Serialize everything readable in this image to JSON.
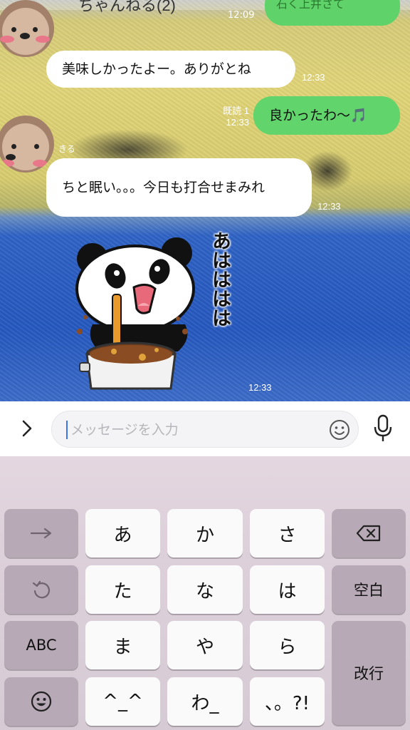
{
  "header": {
    "title_partial": "ちゃんねる(2)",
    "right_partial": "石く上井さて"
  },
  "messages": [
    {
      "id": "m0",
      "side": "right",
      "text": "",
      "time": "12:09"
    },
    {
      "id": "m1",
      "side": "left",
      "text": "美味しかったよー。ありがとね",
      "time": "12:33"
    },
    {
      "id": "m2",
      "side": "right",
      "text": "良かったわ〜🎵",
      "read": "既読 1",
      "time": "12:33"
    },
    {
      "id": "m3",
      "side": "left",
      "sender_partial": "きる",
      "text": "ちと眠い。。。今日も打合せまみれ",
      "time": "12:33"
    },
    {
      "id": "m4",
      "side": "left",
      "type": "sticker",
      "sticker_text": "あはははは",
      "time": "12:33"
    }
  ],
  "input": {
    "placeholder": "メッセージを入力",
    "value": ""
  },
  "icons": {
    "expand": "chevron-right-icon",
    "emoji": "smile-icon",
    "voice": "microphone-icon"
  },
  "keyboard": {
    "rows": [
      [
        "→",
        "あ",
        "か",
        "さ",
        "⌫"
      ],
      [
        "↺",
        "た",
        "な",
        "は",
        "空白"
      ],
      [
        "ABC",
        "ま",
        "や",
        "ら",
        "改行"
      ],
      [
        "☺",
        "^^",
        "わ_",
        "、。?!"
      ]
    ],
    "keys": {
      "arrow": "→",
      "a": "あ",
      "ka": "か",
      "sa": "さ",
      "undo": "↺",
      "ta": "た",
      "na": "な",
      "ha": "は",
      "space": "空白",
      "abc": "ABC",
      "ma": "ま",
      "ya": "や",
      "ra": "ら",
      "enter": "改行",
      "emoji": "☺",
      "face": "^_^",
      "wa": "わ_",
      "punct": "、。?!"
    }
  },
  "colors": {
    "green_bubble": "#61d46b",
    "white_bubble": "#ffffff",
    "cursor": "#3d72e8",
    "keyboard_bg": "#ddd0da",
    "key_dark": "#b7a9b6"
  }
}
